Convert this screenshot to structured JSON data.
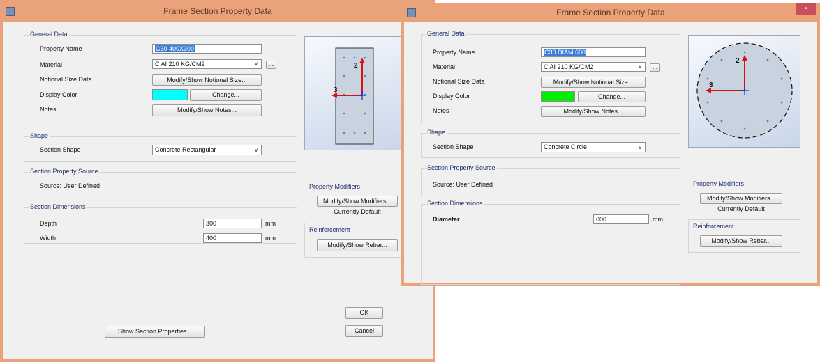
{
  "left": {
    "title": "Frame Section Property Data",
    "general_group": "General Data",
    "property_name_label": "Property Name",
    "property_name_value": "C30 400X300",
    "material_label": "Material",
    "material_value": "C AI 210 KG/CM2",
    "material_more": "...",
    "notional_label": "Notional Size Data",
    "notional_button": "Modify/Show Notional Size...",
    "display_color_label": "Display Color",
    "display_color": "#00ffff",
    "change_button": "Change...",
    "notes_label": "Notes",
    "notes_button": "Modify/Show Notes...",
    "shape_group": "Shape",
    "section_shape_label": "Section Shape",
    "section_shape_value": "Concrete Rectangular",
    "source_group": "Section Property Source",
    "source_text": "Source: User Defined",
    "dimensions_group": "Section Dimensions",
    "depth_label": "Depth",
    "depth_value": "300",
    "width_label": "Width",
    "width_value": "400",
    "unit": "mm",
    "modifiers_group": "Property Modifiers",
    "modifiers_button": "Modify/Show Modifiers...",
    "modifiers_status": "Currently Default",
    "reinforcement_group": "Reinforcement",
    "rebar_button": "Modify/Show Rebar...",
    "show_props_button": "Show Section Properties...",
    "ok_button": "OK",
    "cancel_button": "Cancel",
    "axis2": "2",
    "axis3": "3"
  },
  "right": {
    "title": "Frame Section Property Data",
    "close_glyph": "×",
    "general_group": "General Data",
    "property_name_label": "Property Name",
    "property_name_value": "C30 DIAM 600",
    "material_label": "Material",
    "material_value": "C AI 210 KG/CM2",
    "material_more": "...",
    "notional_label": "Notional Size Data",
    "notional_button": "Modify/Show Notional Size...",
    "display_color_label": "Display Color",
    "display_color": "#00ee00",
    "change_button": "Change...",
    "notes_label": "Notes",
    "notes_button": "Modify/Show Notes...",
    "shape_group": "Shape",
    "section_shape_label": "Section Shape",
    "section_shape_value": "Concrete Circle",
    "source_group": "Section Property Source",
    "source_text": "Source: User Defined",
    "dimensions_group": "Section Dimensions",
    "diameter_label": "Diameter",
    "diameter_value": "600",
    "unit": "mm",
    "modifiers_group": "Property Modifiers",
    "modifiers_button": "Modify/Show Modifiers...",
    "modifiers_status": "Currently Default",
    "reinforcement_group": "Reinforcement",
    "rebar_button": "Modify/Show Rebar...",
    "axis2": "2",
    "axis3": "3"
  },
  "colors": {
    "titlebar": "#e9a27a",
    "axis_red": "#e01010",
    "axis_blue": "#1030d0",
    "rebar_dot": "#4a86c8"
  }
}
